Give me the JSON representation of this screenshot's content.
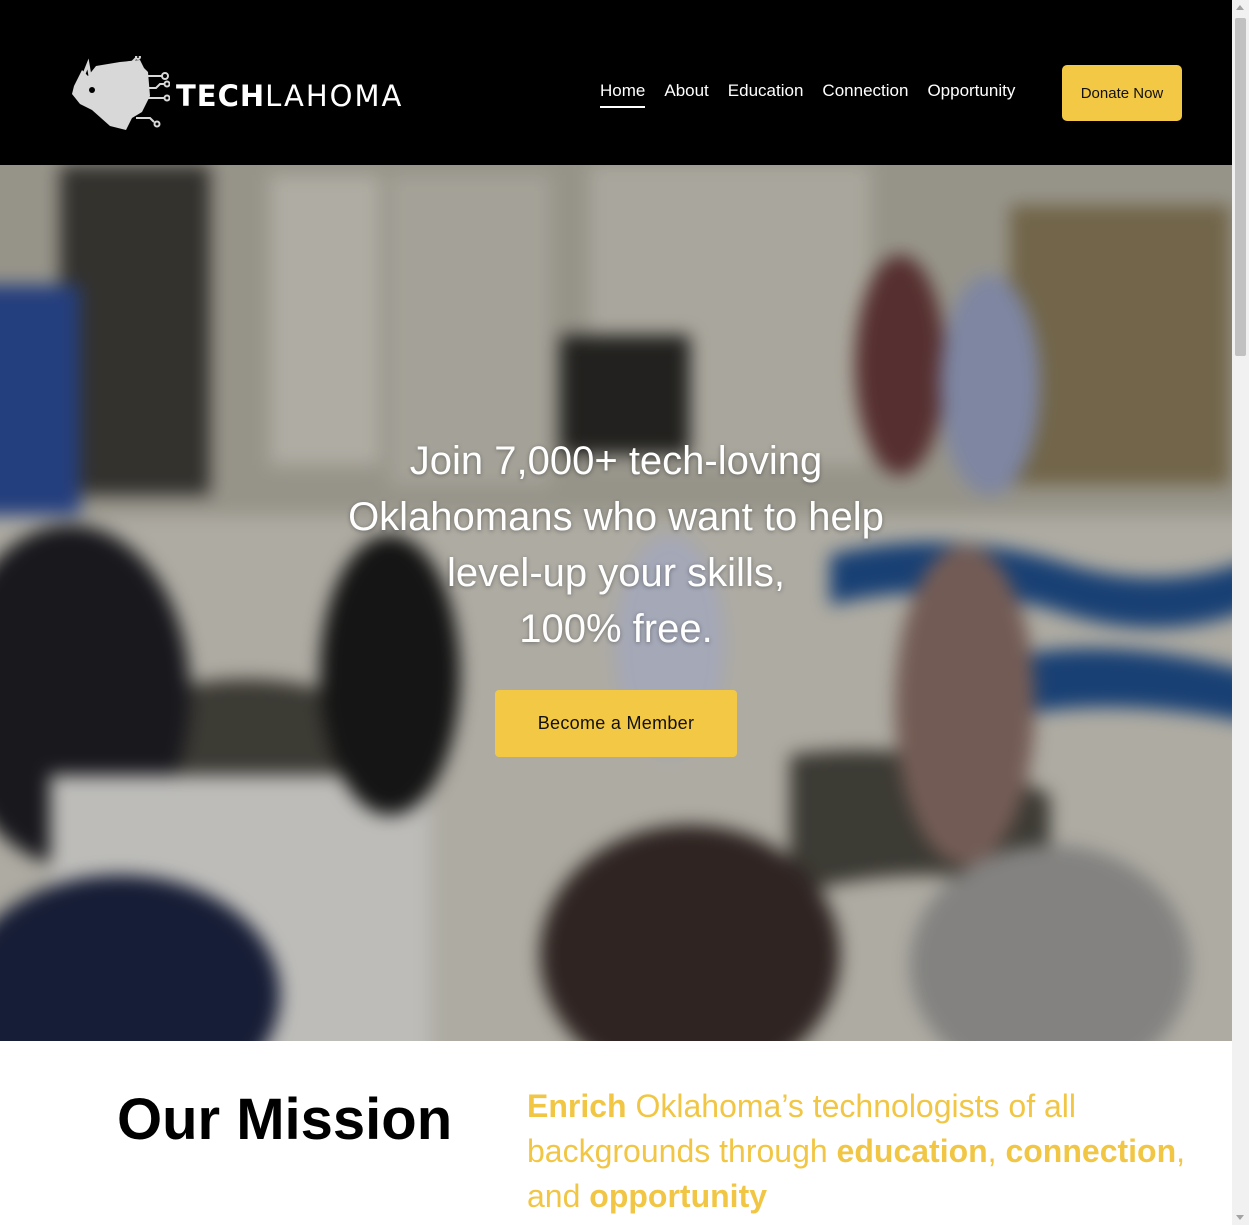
{
  "header": {
    "logo": {
      "text_bold": "TECH",
      "text_light": "LAHOMA",
      "icon": "bison-circuit-logo-icon"
    },
    "nav": [
      {
        "label": "Home",
        "active": true
      },
      {
        "label": "About",
        "active": false
      },
      {
        "label": "Education",
        "active": false
      },
      {
        "label": "Connection",
        "active": false
      },
      {
        "label": "Opportunity",
        "active": false
      }
    ],
    "donate_label": "Donate Now"
  },
  "hero": {
    "lines": [
      "Join 7,000+ tech-loving",
      "Oklahomans who want to help",
      "level-up your skills,",
      "100% free."
    ],
    "cta_label": "Become a Member"
  },
  "mission": {
    "heading": "Our Mission",
    "w1": "Enrich",
    "t1": " Oklahoma’s technologists of all backgrounds through ",
    "w2": "education",
    "t2": ", ",
    "w3": "connection",
    "t3": ", and ",
    "w4": "opportunity"
  },
  "colors": {
    "accent": "#f3c845",
    "header_bg": "#000000",
    "mission_text": "#f2c645"
  }
}
